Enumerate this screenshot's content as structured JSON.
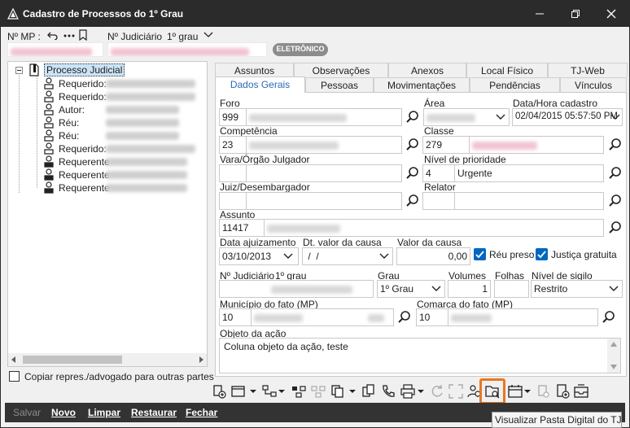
{
  "window": {
    "title": "Cadastro de Processos do 1º Grau",
    "minimize_icon": "minimize-icon",
    "restore_icon": "restore-icon",
    "close_icon": "close-icon"
  },
  "header": {
    "mp_label": "Nº MP :",
    "judiciario_label": "Nº Judiciário",
    "grau_label": "1º grau",
    "badge": "ELETRÔNICO",
    "accent_color": "#2b2b2b"
  },
  "tree": {
    "root": "Processo Judicial",
    "items": [
      {
        "label": "Requerido:"
      },
      {
        "label": "Requerido:"
      },
      {
        "label": "Autor:"
      },
      {
        "label": "Réu:"
      },
      {
        "label": "Réu:"
      },
      {
        "label": "Requerido:"
      },
      {
        "label": "Requerente"
      },
      {
        "label": "Requerente"
      },
      {
        "label": "Requerente"
      }
    ]
  },
  "copy_checkbox_label": "Copiar repres./advogado para outras partes",
  "tabs_row1": [
    "Assuntos",
    "Observações",
    "Anexos",
    "Local Físico",
    "TJ-Web"
  ],
  "tabs_row2": [
    "Dados Gerais",
    "Pessoas",
    "Movimentações",
    "Pendências",
    "Vínculos"
  ],
  "form": {
    "foro": {
      "label": "Foro",
      "value": "999"
    },
    "area": {
      "label": "Área"
    },
    "data_hora": {
      "label": "Data/Hora cadastro",
      "value": "02/04/2015 05:57:50 PM"
    },
    "competencia": {
      "label": "Competência",
      "value": "23"
    },
    "classe": {
      "label": "Classe",
      "value": "279"
    },
    "vara": {
      "label": "Vara/Órgão Julgador"
    },
    "nivel_prioridade": {
      "label": "Nível de prioridade",
      "code": "4",
      "value": "Urgente"
    },
    "juiz": {
      "label": "Juiz/Desembargador"
    },
    "relator": {
      "label": "Relator"
    },
    "assunto": {
      "label": "Assunto",
      "value": "11417"
    },
    "data_ajuizamento": {
      "label": "Data ajuizamento",
      "value": "03/10/2013"
    },
    "dt_valor_causa": {
      "label": "Dt. valor da causa",
      "value": " /  /"
    },
    "valor_causa": {
      "label": "Valor da causa",
      "value": "0,00"
    },
    "reu_preso": {
      "label": "Réu preso",
      "checked": true
    },
    "justica_gratuita": {
      "label": "Justiça gratuita",
      "checked": true
    },
    "n_judiciario": {
      "label": "Nº Judiciário",
      "grau": "1º grau"
    },
    "grau": {
      "label": "Grau",
      "value": "1º Grau"
    },
    "volumes": {
      "label": "Volumes",
      "value": "1"
    },
    "folhas": {
      "label": "Folhas"
    },
    "nivel_sigilo": {
      "label": "Nível de sigilo",
      "value": "Restrito"
    },
    "municipio": {
      "label": "Município do fato (MP)",
      "value": "10"
    },
    "comarca": {
      "label": "Comarca do fato (MP)",
      "value": "10"
    },
    "objeto": {
      "label": "Objeto da ação",
      "value": "Coluna objeto da ação, teste"
    }
  },
  "bottom_buttons": {
    "salvar": "Salvar",
    "novo": "Novo",
    "limpar": "Limpar",
    "restaurar": "Restaurar",
    "fechar": "Fechar"
  },
  "tooltip": "Visualizar Pasta Digital do TJ",
  "highlight_color": "#e87722"
}
